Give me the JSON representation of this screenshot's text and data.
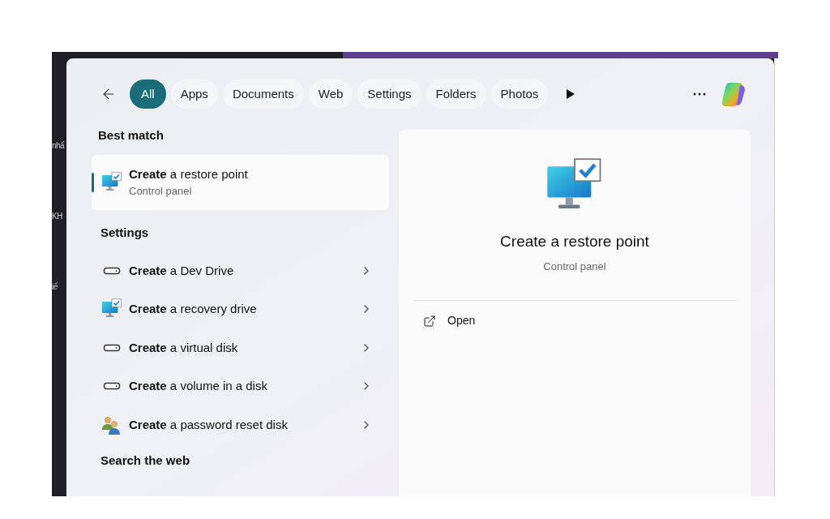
{
  "background_fragments": [
    "nhấ",
    "KH",
    "iế"
  ],
  "filters": [
    {
      "label": "All",
      "selected": true
    },
    {
      "label": "Apps",
      "selected": false
    },
    {
      "label": "Documents",
      "selected": false
    },
    {
      "label": "Web",
      "selected": false
    },
    {
      "label": "Settings",
      "selected": false
    },
    {
      "label": "Folders",
      "selected": false
    },
    {
      "label": "Photos",
      "selected": false
    }
  ],
  "best_match": {
    "heading": "Best match",
    "title": "**Create** a restore point",
    "subtitle": "Control panel",
    "kind": "monitor",
    "selected": true
  },
  "settings": {
    "heading": "Settings",
    "items": [
      {
        "label": "**Create** a Dev Drive",
        "kind": "drive"
      },
      {
        "label": "**Create** a recovery drive",
        "kind": "monitor"
      },
      {
        "label": "**Create** a virtual disk",
        "kind": "drive"
      },
      {
        "label": "**Create** a volume in a disk",
        "kind": "drive"
      },
      {
        "label": "**Create** a password reset disk",
        "kind": "users"
      }
    ]
  },
  "web_heading": "Search the web",
  "preview": {
    "title": "Create a restore point",
    "subtitle": "Control panel",
    "actions": [
      "Open"
    ]
  }
}
